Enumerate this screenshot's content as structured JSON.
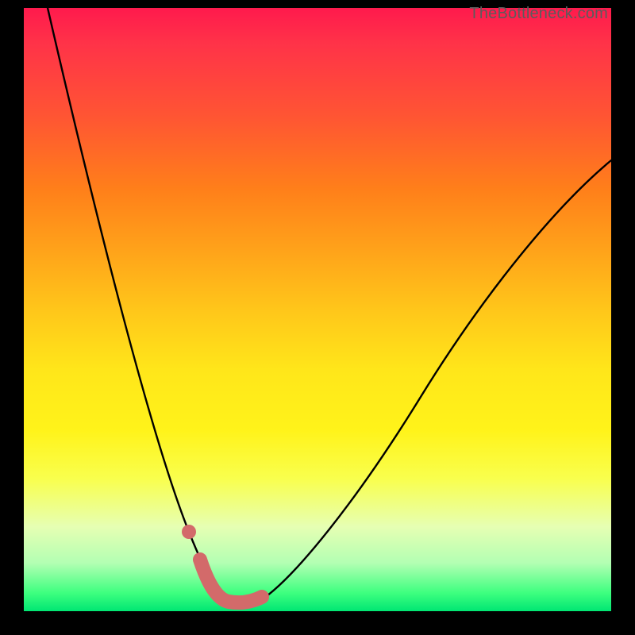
{
  "watermark": {
    "text": "TheBottleneck.com"
  },
  "chart_data": {
    "type": "line",
    "title": "",
    "xlabel": "",
    "ylabel": "",
    "xlim": [
      0,
      100
    ],
    "ylim": [
      0,
      100
    ],
    "grid": false,
    "series": [
      {
        "name": "bottleneck-curve",
        "x": [
          4,
          8,
          12,
          16,
          20,
          22,
          24,
          26,
          28,
          30,
          32,
          34,
          36,
          40,
          45,
          50,
          55,
          60,
          65,
          70,
          75,
          80,
          85,
          90,
          95,
          100
        ],
        "y": [
          100,
          81,
          63,
          47,
          33,
          27,
          21,
          15,
          10,
          6,
          3,
          1,
          0,
          1,
          4,
          9,
          15,
          22,
          29,
          36,
          44,
          52,
          60,
          68,
          72,
          75
        ]
      }
    ],
    "annotations": [
      {
        "name": "optimal-range-marker",
        "x_start": 27,
        "x_end": 40,
        "y_approx": 2
      },
      {
        "name": "marker-dot",
        "x": 26,
        "y": 10
      }
    ],
    "background_gradient": {
      "top": "#ff1a4d",
      "mid": "#ffe61a",
      "bottom": "#00e673"
    }
  }
}
